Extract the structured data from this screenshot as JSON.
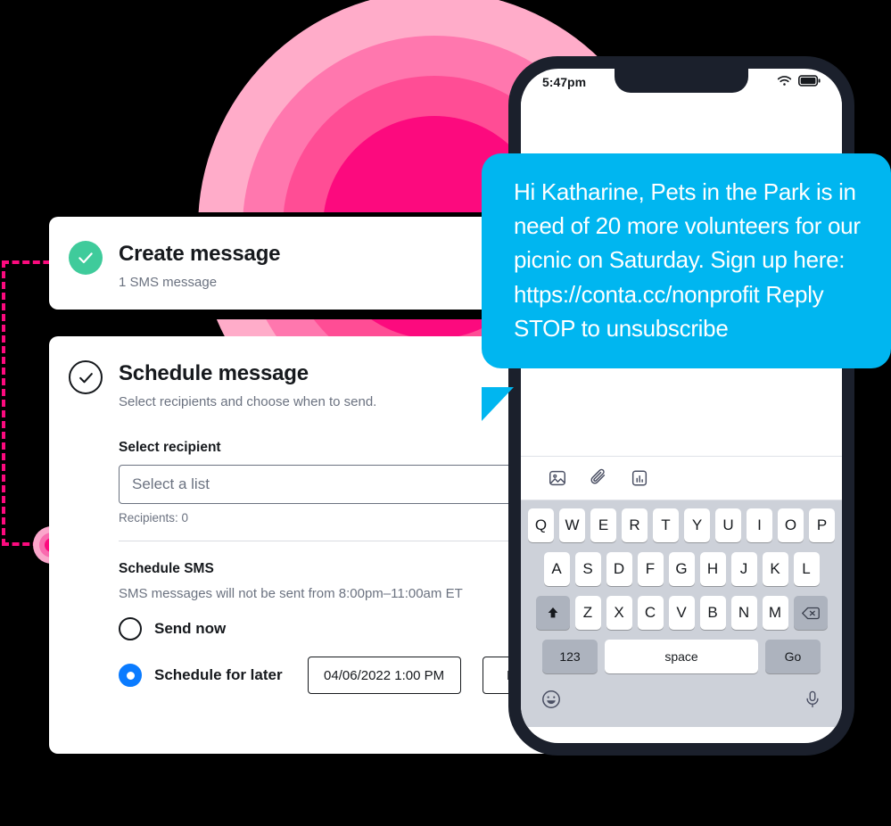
{
  "background": {
    "color": "#000000"
  },
  "decor": {
    "arcs": [
      {
        "name": "arc-outer",
        "color": "#FFACC9"
      },
      {
        "name": "arc-second",
        "color": "#FF77AE"
      },
      {
        "name": "arc-third",
        "color": "#FF4D95"
      },
      {
        "name": "arc-inner",
        "color": "#FC0A7E"
      }
    ],
    "connector": {
      "line_color": "#FC0A7E",
      "node_outer_color": "#FBA6CB",
      "node_mid_color": "#F96BAF",
      "node_core_color": "#FC0A7E"
    }
  },
  "cards": {
    "create": {
      "status_icon": "check-circle-filled-icon",
      "status_color": "#3FCB9B",
      "title": "Create message",
      "subtitle": "1 SMS message"
    },
    "schedule": {
      "status_icon": "check-circle-outline-icon",
      "title": "Schedule message",
      "subtitle": "Select recipients and choose when to send.",
      "recipient": {
        "label": "Select recipient",
        "select_value": "Select a list",
        "helper": "Recipients: 0"
      },
      "schedule_sms": {
        "label": "Schedule SMS",
        "note": "SMS messages will not be sent from 8:00pm–11:00am ET",
        "options": [
          {
            "label": "Send now",
            "selected": false
          },
          {
            "label": "Schedule for later",
            "selected": true
          }
        ],
        "selected_color": "#0A7BFF",
        "date_value": "04/06/2022 1:00 PM",
        "timezone_value": "EST"
      }
    }
  },
  "phone": {
    "frame_color": "#1b202c",
    "status_bar": {
      "time": "5:47pm",
      "wifi_icon": "wifi-icon",
      "battery_icon": "battery-icon"
    },
    "attachment_bar": {
      "icons": [
        "image-icon",
        "paperclip-icon",
        "poll-chart-icon"
      ]
    },
    "keyboard": {
      "row1": [
        "Q",
        "W",
        "E",
        "R",
        "T",
        "Y",
        "U",
        "I",
        "O",
        "P"
      ],
      "row2": [
        "A",
        "S",
        "D",
        "F",
        "G",
        "H",
        "J",
        "K",
        "L"
      ],
      "row3_shift_icon": "shift-up-arrow-icon",
      "row3": [
        "Z",
        "X",
        "C",
        "V",
        "B",
        "N",
        "M"
      ],
      "row3_backspace_icon": "backspace-icon",
      "numbers_key": "123",
      "space_key": "space",
      "go_key": "Go"
    },
    "bottom_bar": {
      "emoji_icon": "smiley-face-icon",
      "mic_icon": "microphone-icon"
    }
  },
  "message_bubble": {
    "color": "#00B6F0",
    "text": "Hi Katharine, Pets in the Park is in need of 20 more volunteers for our picnic on Saturday. Sign up here: https://conta.cc/nonprofit Reply STOP to unsubscribe"
  }
}
